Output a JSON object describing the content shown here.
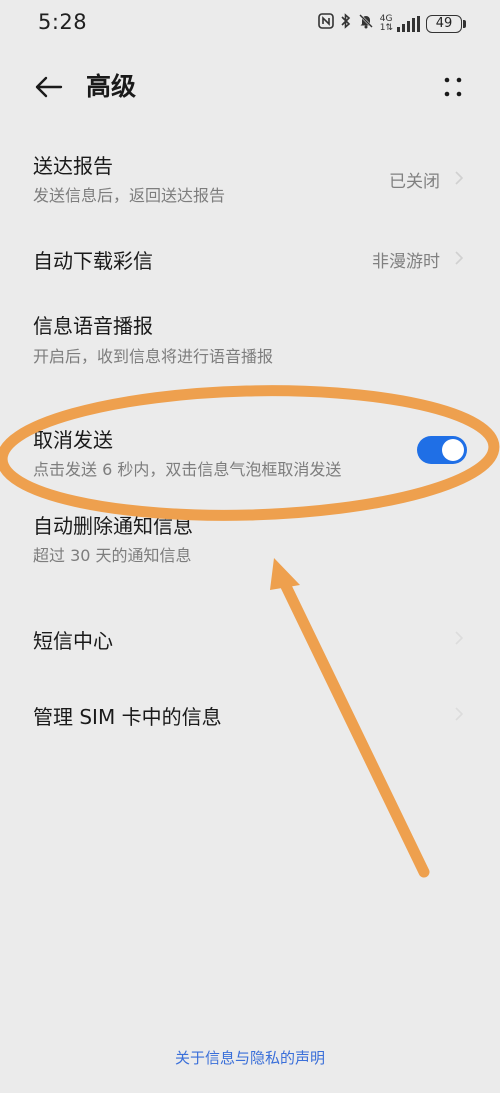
{
  "status_bar": {
    "time": "5:28",
    "nfc_icon": "N",
    "network_label_top": "4G",
    "network_label_bottom": "1⇅",
    "battery": "49"
  },
  "header": {
    "title": "高级"
  },
  "settings": [
    {
      "title": "送达报告",
      "subtitle": "发送信息后，返回送达报告",
      "value": "已关闭"
    },
    {
      "title": "自动下载彩信",
      "value": "非漫游时"
    },
    {
      "title": "信息语音播报",
      "subtitle": "开启后，收到信息将进行语音播报"
    },
    {
      "title": "取消发送",
      "subtitle": "点击发送 6 秒内，双击信息气泡框取消发送",
      "toggle_on": true
    },
    {
      "title": "自动删除通知信息",
      "subtitle": "超过 30 天的通知信息"
    },
    {
      "title": "短信中心"
    },
    {
      "title": "管理 SIM 卡中的信息"
    }
  ],
  "footer": {
    "privacy_link": "关于信息与隐私的声明"
  },
  "colors": {
    "background": "#ebebeb",
    "toggle_on": "#1f6fe6",
    "link": "#3a6fd9",
    "annotation": "#eea04e"
  },
  "icons": {
    "back": "back-arrow-icon",
    "more": "more-dots-icon",
    "nfc": "nfc-icon",
    "bluetooth": "bluetooth-icon",
    "mute": "bell-muted-icon",
    "signal": "signal-bars-icon",
    "battery": "battery-icon",
    "chevron": "chevron-right-icon"
  }
}
